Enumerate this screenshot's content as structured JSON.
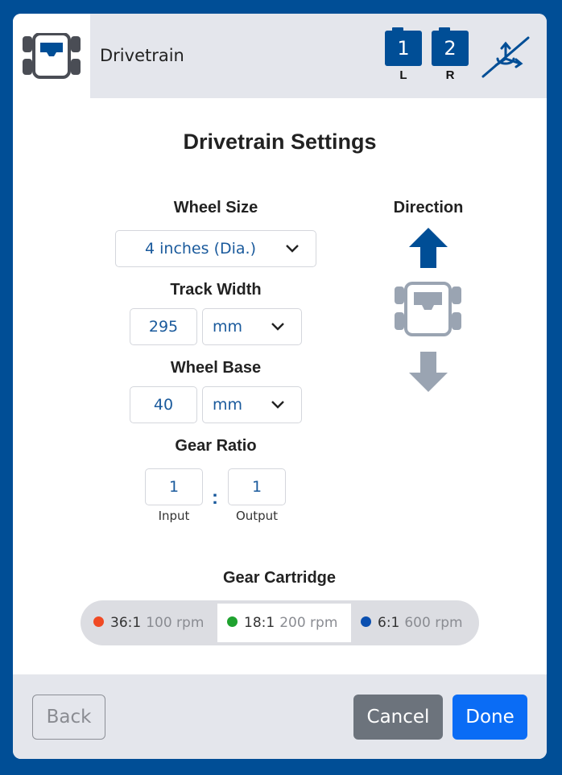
{
  "header": {
    "title": "Drivetrain",
    "ports": [
      {
        "number": "1",
        "label": "L"
      },
      {
        "number": "2",
        "label": "R"
      }
    ],
    "icons": [
      "drivetrain-icon",
      "gyro-disabled-icon"
    ]
  },
  "title": "Drivetrain Settings",
  "wheel_size": {
    "label": "Wheel Size",
    "value": "4 inches (Dia.)"
  },
  "track_width": {
    "label": "Track Width",
    "value": "295",
    "unit": "mm"
  },
  "wheel_base": {
    "label": "Wheel Base",
    "value": "40",
    "unit": "mm"
  },
  "gear_ratio": {
    "label": "Gear Ratio",
    "input_value": "1",
    "output_value": "1",
    "separator": ":",
    "input_label": "Input",
    "output_label": "Output"
  },
  "direction": {
    "label": "Direction",
    "selected": "forward"
  },
  "gear_cartridge": {
    "label": "Gear Cartridge",
    "options": [
      {
        "ratio": "36:1",
        "rpm": "100 rpm",
        "color": "#f04a24"
      },
      {
        "ratio": "18:1",
        "rpm": "200 rpm",
        "color": "#1fa22f"
      },
      {
        "ratio": "6:1",
        "rpm": "600 rpm",
        "color": "#0a4fb0"
      }
    ],
    "selected_index": 1
  },
  "footer": {
    "back_label": "Back",
    "cancel_label": "Cancel",
    "done_label": "Done"
  },
  "colors": {
    "brand_blue": "#004e96",
    "done_blue": "#0a6cf5",
    "cancel_gray": "#6c737c",
    "value_blue": "#1a5a9c"
  }
}
